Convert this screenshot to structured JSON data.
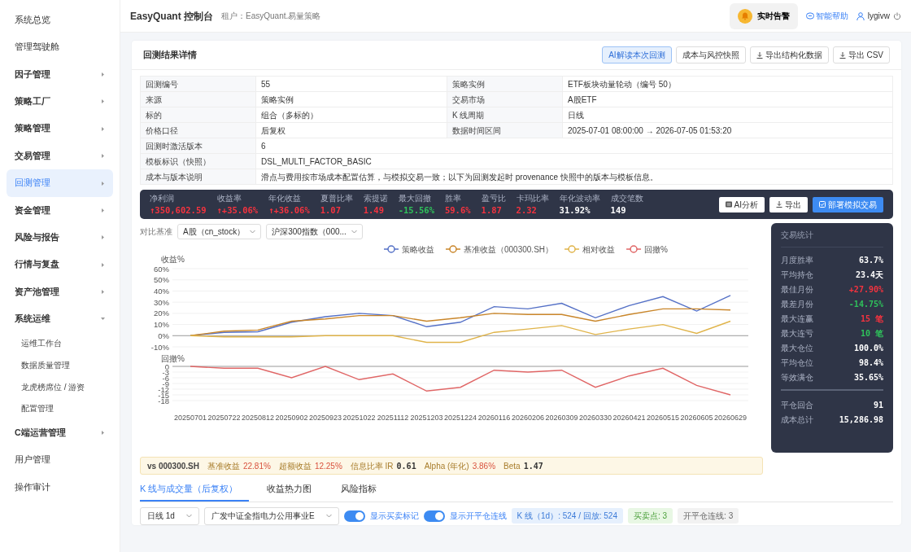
{
  "sidebar": {
    "items": [
      {
        "label": "系统总览",
        "kind": "link",
        "selected": false
      },
      {
        "label": "管理驾驶舱",
        "kind": "link",
        "selected": false
      },
      {
        "label": "因子管理",
        "kind": "group",
        "selected": false,
        "expanded": false
      },
      {
        "label": "策略工厂",
        "kind": "group",
        "selected": false,
        "expanded": false
      },
      {
        "label": "策略管理",
        "kind": "group",
        "selected": false,
        "expanded": false
      },
      {
        "label": "交易管理",
        "kind": "group",
        "selected": false,
        "expanded": false
      },
      {
        "label": "回测管理",
        "kind": "group",
        "selected": true,
        "expanded": false
      },
      {
        "label": "资金管理",
        "kind": "group",
        "selected": false,
        "expanded": false
      },
      {
        "label": "风险与报告",
        "kind": "group",
        "selected": false,
        "expanded": false
      },
      {
        "label": "行情与复盘",
        "kind": "group",
        "selected": false,
        "expanded": false
      },
      {
        "label": "资产池管理",
        "kind": "group",
        "selected": false,
        "expanded": false
      },
      {
        "label": "系统运维",
        "kind": "group",
        "selected": false,
        "expanded": true,
        "children": [
          {
            "label": "运维工作台",
            "selected": false
          },
          {
            "label": "数据质量管理",
            "selected": false
          },
          {
            "label": "龙虎榜席位 / 游资",
            "selected": false
          },
          {
            "label": "配置管理",
            "selected": false
          }
        ]
      },
      {
        "label": "C端运营管理",
        "kind": "group",
        "selected": false,
        "expanded": false
      },
      {
        "label": "用户管理",
        "kind": "link",
        "selected": false
      },
      {
        "label": "操作审计",
        "kind": "link",
        "selected": false
      }
    ]
  },
  "header": {
    "title": "EasyQuant 控制台",
    "tenant": "租户：EasyQuant.易量策略",
    "alert": "实时告警",
    "help": "智能帮助",
    "user": "lygivw"
  },
  "card": {
    "title": "回测结果详情",
    "actions": [
      {
        "label": "AI解读本次回测",
        "kind": "primary"
      },
      {
        "label": "成本与风控快照",
        "kind": "plain"
      },
      {
        "label": "导出结构化数据",
        "kind": "download"
      },
      {
        "label": "导出 CSV",
        "kind": "download"
      }
    ]
  },
  "info_table": [
    [
      {
        "label": "回测编号",
        "value": "55"
      },
      {
        "label": "策略实例",
        "value": "ETF板块动量轮动（编号 50）"
      }
    ],
    [
      {
        "label": "来源",
        "value": "策略实例"
      },
      {
        "label": "交易市场",
        "value": "A股ETF"
      }
    ],
    [
      {
        "label": "标的",
        "value": "组合（多标的）"
      },
      {
        "label": "K 线周期",
        "value": "日线"
      }
    ],
    [
      {
        "label": "价格口径",
        "value": "后复权"
      },
      {
        "label": "数据时间区间",
        "value": "2025-07-01 08:00:00 → 2026-07-05 01:53:20"
      }
    ],
    [
      {
        "label": "回测时激活版本",
        "value": "6"
      }
    ],
    [
      {
        "label": "模板标识（快照）",
        "value": "DSL_MULTI_FACTOR_BASIC"
      }
    ],
    [
      {
        "label": "成本与版本说明",
        "value": "滑点与费用按市场成本配置估算，与模拟交易一致；以下为回测发起时 provenance 快照中的版本与模板信息。"
      }
    ]
  ],
  "metrics": [
    {
      "label": "净利润",
      "value": "↑350,602.59",
      "color": "#f5333f"
    },
    {
      "label": "收益率",
      "value": "↑+35.06%",
      "color": "#f5333f"
    },
    {
      "label": "年化收益",
      "value": "↑+36.06%",
      "color": "#f5333f"
    },
    {
      "label": "夏普比率",
      "value": "1.07",
      "color": "#f5333f"
    },
    {
      "label": "索提诺",
      "value": "1.49",
      "color": "#f5333f"
    },
    {
      "label": "最大回撤",
      "value": "-15.56%",
      "color": "#2fc25b"
    },
    {
      "label": "胜率",
      "value": "59.6%",
      "color": "#f5333f"
    },
    {
      "label": "盈亏比",
      "value": "1.87",
      "color": "#f5333f"
    },
    {
      "label": "卡玛比率",
      "value": "2.32",
      "color": "#f5333f"
    },
    {
      "label": "年化波动率",
      "value": "31.92%",
      "color": "#ffffff"
    },
    {
      "label": "成交笔数",
      "value": "149",
      "color": "#ffffff"
    }
  ],
  "metric_actions": [
    {
      "label": "AI分析",
      "kind": "plain"
    },
    {
      "label": "导出",
      "kind": "download"
    },
    {
      "label": "部署模拟交易",
      "kind": "primary"
    }
  ],
  "compare": {
    "label": "对比基准",
    "market": "A股（cn_stock）",
    "index": "沪深300指数（000..."
  },
  "charts": [
    {
      "chart_data": {
        "type": "line",
        "ylabel": "收益%",
        "grid": true,
        "legend": "top",
        "ylim": [
          -10,
          60
        ],
        "yticks": [
          {
            "value": -10,
            "label": "-10%"
          },
          {
            "value": 0,
            "label": "0%"
          },
          {
            "value": 10,
            "label": "10%"
          },
          {
            "value": 20,
            "label": "20%"
          },
          {
            "value": 30,
            "label": "30%"
          },
          {
            "value": 40,
            "label": "40%"
          },
          {
            "value": 50,
            "label": "50%"
          },
          {
            "value": 60,
            "label": "60%"
          }
        ],
        "series": [
          {
            "name": "策略收益",
            "color": "#5470c6",
            "values": [
              0,
              3,
              3.5,
              12,
              17,
              20,
              18,
              8,
              12,
              26,
              24,
              29,
              16,
              27,
              35,
              22,
              36
            ]
          },
          {
            "name": "基准收益（000300.SH）",
            "color": "#c9862a",
            "values": [
              0,
              4,
              5,
              13,
              15,
              18,
              18,
              13,
              16,
              20,
              19,
              19,
              13,
              19,
              24,
              24,
              23
            ]
          },
          {
            "name": "相对收益",
            "color": "#e0b44a",
            "values": [
              0,
              -1,
              -1,
              -1,
              0,
              0,
              0,
              -6,
              -6,
              3,
              6,
              9,
              1,
              6,
              10,
              2,
              13
            ]
          }
        ]
      }
    },
    {
      "chart_data": {
        "type": "line",
        "ylabel": "回撤%",
        "grid": true,
        "x": [
          "20250701",
          "20250722",
          "20250812",
          "20250902",
          "20250923",
          "20251022",
          "20251112",
          "20251203",
          "20251224",
          "20260116",
          "20260206",
          "20260309",
          "20260330",
          "20260421",
          "20260515",
          "20260605",
          "20260629"
        ],
        "ylim": [
          -18,
          0
        ],
        "yticks": [
          0,
          -3,
          -6,
          -9,
          -12,
          -15,
          -18
        ],
        "series": [
          {
            "name": "回撤%",
            "color": "#e06666",
            "values": [
              0,
              -1,
              -1,
              -6,
              0,
              -7,
              -4,
              -13,
              -11,
              -2,
              -3,
              -2,
              -11,
              -5,
              -1,
              -10,
              -15
            ]
          }
        ]
      }
    }
  ],
  "stats": {
    "title": "交易统计",
    "rows": [
      {
        "label": "月度胜率",
        "value": "63.7%",
        "color": "#ffffff"
      },
      {
        "label": "平均持仓",
        "value": "23.4天",
        "color": "#ffffff"
      },
      {
        "label": "最佳月份",
        "value": "+27.90%",
        "color": "#f5333f"
      },
      {
        "label": "最差月份",
        "value": "-14.75%",
        "color": "#2fc25b"
      },
      {
        "label": "最大连赢",
        "value": "15 笔",
        "color": "#f5333f"
      },
      {
        "label": "最大连亏",
        "value": "10 笔",
        "color": "#2fc25b"
      },
      {
        "label": "最大仓位",
        "value": "100.0%",
        "color": "#ffffff"
      },
      {
        "label": "平均仓位",
        "value": "98.4%",
        "color": "#ffffff"
      },
      {
        "label": "等效满仓",
        "value": "35.65%",
        "color": "#ffffff"
      }
    ],
    "footer": [
      {
        "label": "平仓回合",
        "value": "91"
      },
      {
        "label": "成本总计",
        "value": "15,286.98"
      }
    ]
  },
  "benchmark_strip": {
    "title": "vs 000300.SH",
    "items": [
      {
        "label": "基准收益",
        "value": "22.81%",
        "kind": "pct"
      },
      {
        "label": "超额收益",
        "value": "12.25%",
        "kind": "pct"
      },
      {
        "label": "信息比率 IR",
        "value": "0.61",
        "kind": "num"
      },
      {
        "label": "Alpha (年化)",
        "value": "3.86%",
        "kind": "pct"
      },
      {
        "label": "Beta",
        "value": "1.47",
        "kind": "num"
      }
    ]
  },
  "tabs": [
    {
      "label": "K 线与成交量（后复权）",
      "selected": true
    },
    {
      "label": "收益热力图",
      "selected": false
    },
    {
      "label": "风险指标",
      "selected": false
    }
  ],
  "toolbar": {
    "period": "日线 1d",
    "instrument": "广发中证全指电力公用事业E",
    "toggles": [
      {
        "label": "显示买卖标记",
        "on": true
      },
      {
        "label": "显示开平仓连线",
        "on": true
      }
    ],
    "tags": [
      {
        "label": "K 线（1d）: 524 / 回放: 524",
        "kind": "info"
      },
      {
        "label": "买卖点: 3",
        "kind": "success"
      },
      {
        "label": "开平仓连线: 3",
        "kind": "plain"
      }
    ]
  }
}
